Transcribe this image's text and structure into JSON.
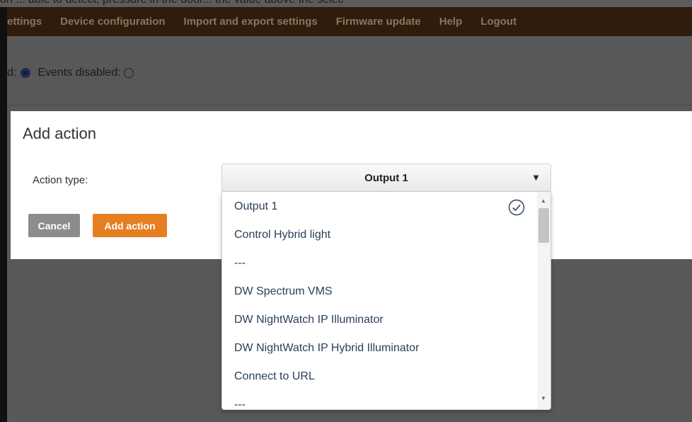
{
  "top_strip": {
    "text": "on ... able to detect, pressure in the door... the value above the selec"
  },
  "nav": {
    "items": [
      "ettings",
      "Device configuration",
      "Import and export settings",
      "Firmware update",
      "Help",
      "Logout"
    ]
  },
  "events": {
    "enabled_label": "d:",
    "disabled_label": "Events disabled:"
  },
  "modal": {
    "title": "Add action",
    "action_type_label": "Action type:",
    "cancel_label": "Cancel",
    "add_label": "Add action"
  },
  "select": {
    "value": "Output 1",
    "arrow": "▼"
  },
  "dropdown": {
    "options": [
      "Output 1",
      "Control Hybrid light",
      "---",
      "DW Spectrum VMS",
      "DW NightWatch IP Illuminator",
      "DW NightWatch IP Hybrid Illuminator",
      "Connect to URL",
      "---"
    ]
  },
  "colors": {
    "navbar": "#2f1c0c",
    "add_button": "#e67e22",
    "cancel_button": "#8c8c8c"
  }
}
